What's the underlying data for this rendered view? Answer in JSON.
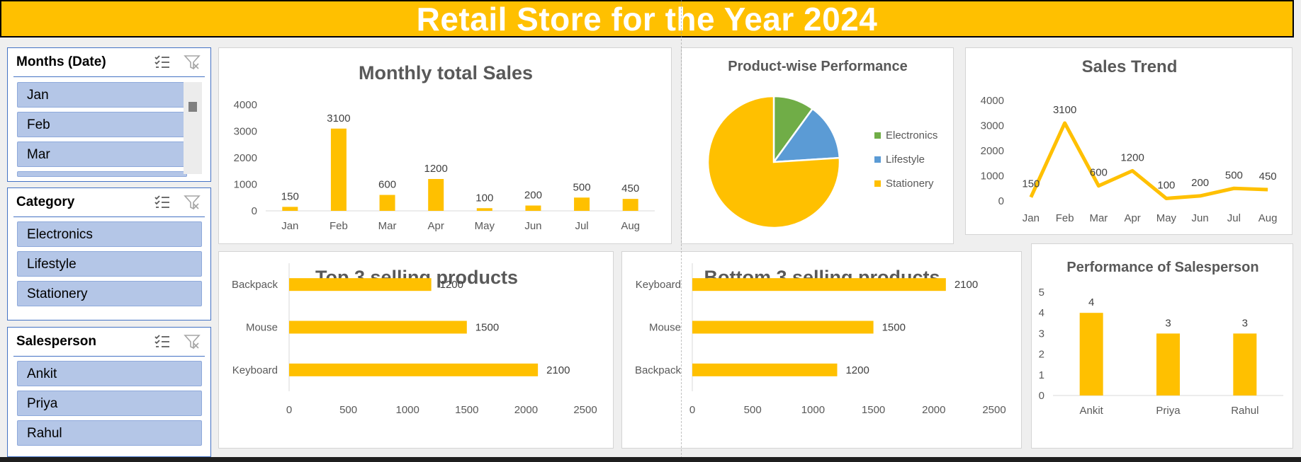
{
  "banner": {
    "title": "Retail Store for the Year 2024"
  },
  "colors": {
    "bar": "#ffc000",
    "accent": "#4472c4",
    "slicer_item": "#b4c6e7",
    "pie_electronics": "#70ad47",
    "pie_lifestyle": "#5b9bd5",
    "pie_stationery": "#ffc000"
  },
  "slicers": {
    "months": {
      "title": "Months (Date)",
      "items": [
        "Jan",
        "Feb",
        "Mar"
      ]
    },
    "category": {
      "title": "Category",
      "items": [
        "Electronics",
        "Lifestyle",
        "Stationery"
      ]
    },
    "salesperson": {
      "title": "Salesperson",
      "items": [
        "Ankit",
        "Priya",
        "Rahul"
      ]
    },
    "icons": [
      "multi-select-icon",
      "clear-filter-icon"
    ]
  },
  "chart_data": [
    {
      "id": "monthly",
      "type": "bar",
      "title": "Monthly total Sales",
      "categories": [
        "Jan",
        "Feb",
        "Mar",
        "Apr",
        "May",
        "Jun",
        "Jul",
        "Aug"
      ],
      "values": [
        150,
        3100,
        600,
        1200,
        100,
        200,
        500,
        450
      ],
      "ylim": [
        0,
        4000
      ],
      "yticks": [
        0,
        1000,
        2000,
        3000,
        4000
      ],
      "grid": false
    },
    {
      "id": "pie",
      "type": "pie",
      "title": "Product-wise Performance",
      "categories": [
        "Electronics",
        "Lifestyle",
        "Stationery"
      ],
      "values": [
        10,
        14,
        76
      ],
      "legend": "right"
    },
    {
      "id": "trend",
      "type": "line",
      "title": "Sales Trend",
      "categories": [
        "Jan",
        "Feb",
        "Mar",
        "Apr",
        "May",
        "Jun",
        "Jul",
        "Aug"
      ],
      "values": [
        150,
        3100,
        600,
        1200,
        100,
        200,
        500,
        450
      ],
      "ylim": [
        0,
        4000
      ],
      "yticks": [
        0,
        1000,
        2000,
        3000,
        4000
      ]
    },
    {
      "id": "top3",
      "type": "bar",
      "orientation": "horizontal",
      "title": "Top 3 selling products",
      "categories": [
        "Backpack",
        "Mouse",
        "Keyboard"
      ],
      "values": [
        1200,
        1500,
        2100
      ],
      "xlim": [
        0,
        2500
      ],
      "xticks": [
        0,
        500,
        1000,
        1500,
        2000,
        2500
      ]
    },
    {
      "id": "bottom3",
      "type": "bar",
      "orientation": "horizontal",
      "title": "Bottom 3 selling products",
      "categories": [
        "Keyboard",
        "Mouse",
        "Backpack"
      ],
      "values": [
        2100,
        1500,
        1200
      ],
      "xlim": [
        0,
        2500
      ],
      "xticks": [
        0,
        500,
        1000,
        1500,
        2000,
        2500
      ]
    },
    {
      "id": "salesperson",
      "type": "bar",
      "title": "Performance of Salesperson",
      "categories": [
        "Ankit",
        "Priya",
        "Rahul"
      ],
      "values": [
        4,
        3,
        3
      ],
      "ylim": [
        0,
        5
      ],
      "yticks": [
        0,
        1,
        2,
        3,
        4,
        5
      ]
    }
  ]
}
